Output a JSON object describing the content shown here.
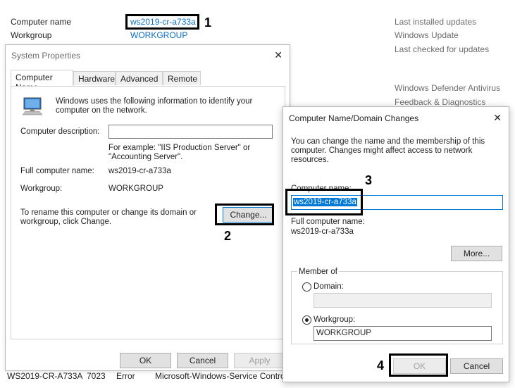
{
  "background": {
    "computer_name_label": "Computer name",
    "computer_name_value": "ws2019-cr-a733a",
    "workgroup_label": "Workgroup",
    "workgroup_value": "WORKGROUP",
    "right_links": [
      "Last installed updates",
      "Windows Update",
      "Last checked for updates",
      "Windows Defender Antivirus",
      "Feedback & Diagnostics"
    ],
    "event_row": {
      "server": "WS2019-CR-A733A",
      "id": "7023",
      "level": "Error",
      "source": "Microsoft-Windows-Service Contro"
    }
  },
  "system_properties": {
    "title": "System Properties",
    "tabs": [
      "Computer Name",
      "Hardware",
      "Advanced",
      "Remote"
    ],
    "intro": "Windows uses the following information to identify your computer on the network.",
    "description_label": "Computer description:",
    "example": "For example: \"IIS Production Server\" or \"Accounting Server\".",
    "full_name_label": "Full computer name:",
    "full_name_value": "ws2019-cr-a733a",
    "workgroup_label": "Workgroup:",
    "workgroup_value": "WORKGROUP",
    "rename_text": "To rename this computer or change its domain or workgroup, click Change.",
    "change_button": "Change...",
    "ok_button": "OK",
    "cancel_button": "Cancel",
    "apply_button": "Apply"
  },
  "name_changes": {
    "title": "Computer Name/Domain Changes",
    "intro": "You can change the name and the membership of this computer. Changes might affect access to network resources.",
    "computer_name_label": "Computer name:",
    "computer_name_value": "ws2019-cr-a733a",
    "full_name_label": "Full computer name:",
    "full_name_value": "ws2019-cr-a733a",
    "more_button": "More...",
    "member_of_label": "Member of",
    "domain_label": "Domain:",
    "domain_value": "",
    "workgroup_label": "Workgroup:",
    "workgroup_value": "WORKGROUP",
    "selected_option": "Workgroup",
    "ok_button": "OK",
    "cancel_button": "Cancel"
  },
  "callouts": [
    "1",
    "2",
    "3",
    "4"
  ],
  "icons": {
    "computer": "computer-monitor-icon",
    "close": "close-icon"
  }
}
